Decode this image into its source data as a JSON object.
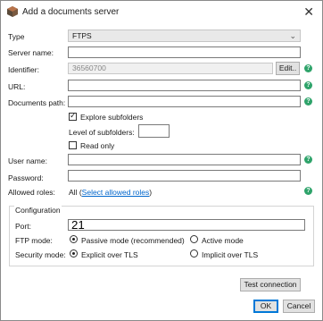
{
  "window": {
    "title": "Add a documents server"
  },
  "form": {
    "type_label": "Type",
    "type_value": "FTPS",
    "server_name_label": "Server name:",
    "server_name_value": "",
    "identifier_label": "Identifier:",
    "identifier_value": "36560700",
    "edit_button": "Edit..",
    "url_label": "URL:",
    "url_value": "",
    "documents_path_label": "Documents path:",
    "documents_path_value": "",
    "explore_subfolders_label": "Explore subfolders",
    "explore_subfolders_checked": true,
    "level_of_subfolders_label": "Level of subfolders:",
    "level_of_subfolders_value": "",
    "read_only_label": "Read only",
    "read_only_checked": false,
    "user_name_label": "User name:",
    "user_name_value": "",
    "password_label": "Password:",
    "password_value": "",
    "allowed_roles_label": "Allowed roles:",
    "allowed_roles_value": "All",
    "allowed_roles_open": "(",
    "select_allowed_roles_link": "Select allowed roles",
    "allowed_roles_close": ")"
  },
  "configuration": {
    "group_label": "Configuration",
    "port_label": "Port:",
    "port_value": "21",
    "ftp_mode_label": "FTP mode:",
    "ftp_mode_options": [
      "Passive mode (recommended)",
      "Active mode"
    ],
    "ftp_mode_selected": "Passive mode (recommended)",
    "security_mode_label": "Security mode:",
    "security_mode_options": [
      "Explicit over TLS",
      "Implicit over TLS"
    ],
    "security_mode_selected": "Explicit over TLS"
  },
  "buttons": {
    "test_connection": "Test connection",
    "ok": "OK",
    "cancel": "Cancel"
  },
  "icons": {
    "help": "?",
    "close": "✕",
    "chevron": "⌄",
    "check": "✓"
  },
  "colors": {
    "help_green": "#2ea36a",
    "link_blue": "#0066cc",
    "focus_blue": "#0078d7"
  }
}
